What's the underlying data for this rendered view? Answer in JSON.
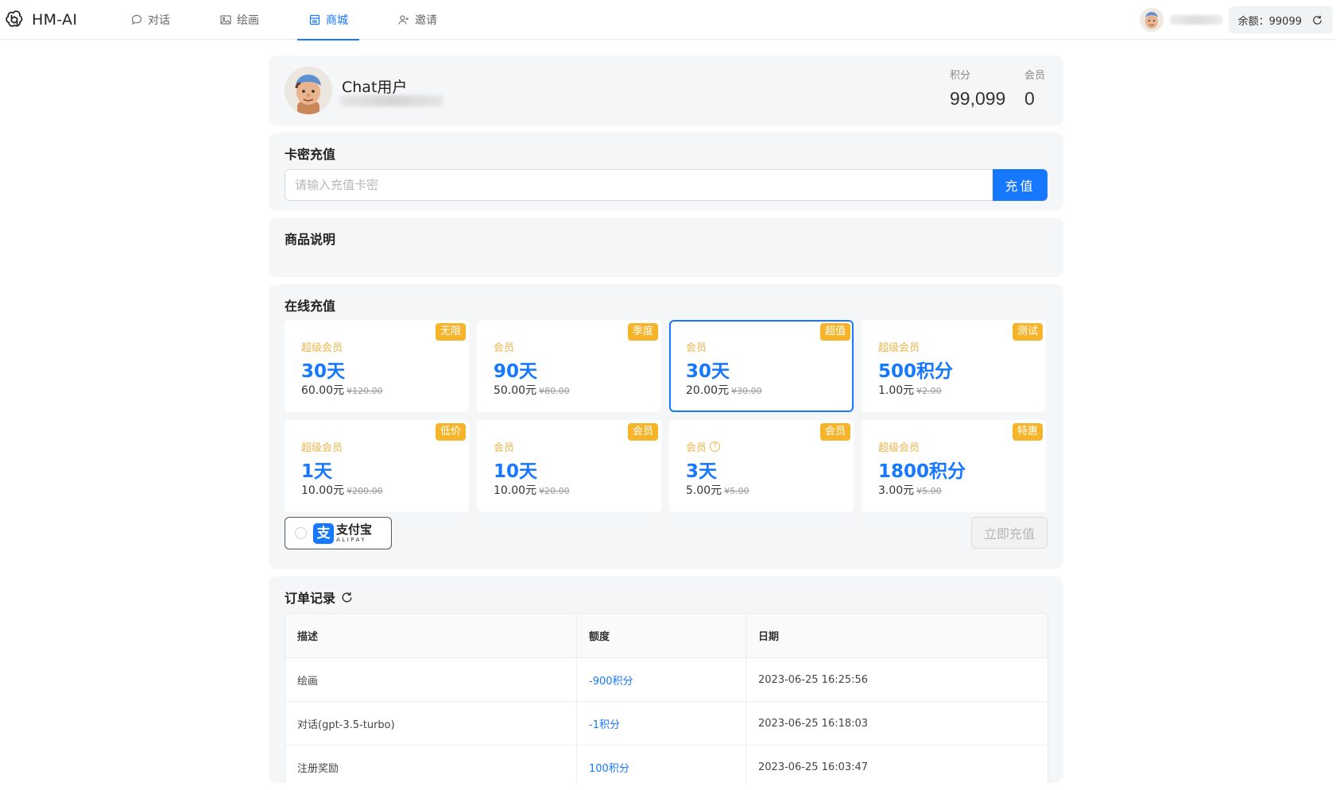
{
  "app": {
    "name": "HM-AI"
  },
  "nav": {
    "items": [
      {
        "label": "对话",
        "icon": "chat-bubble-icon",
        "active": false
      },
      {
        "label": "绘画",
        "icon": "image-icon",
        "active": false
      },
      {
        "label": "商城",
        "icon": "store-icon",
        "active": true
      },
      {
        "label": "邀请",
        "icon": "invite-users-icon",
        "active": false
      }
    ]
  },
  "header": {
    "balance_text": "余额：99099"
  },
  "profile": {
    "name": "Chat用户",
    "points_label": "积分",
    "points_value": "99,099",
    "member_label": "会员",
    "member_value": "0"
  },
  "card_key": {
    "title": "卡密充值",
    "placeholder": "请输入充值卡密",
    "button_label": "充值"
  },
  "description": {
    "title": "商品说明"
  },
  "online": {
    "title": "在线充值",
    "packages": [
      {
        "tag": "无限",
        "type": "超级会员",
        "title": "30天",
        "price": "60.00元",
        "original": "¥120.00",
        "selected": false,
        "help": false
      },
      {
        "tag": "季度",
        "type": "会员",
        "title": "90天",
        "price": "50.00元",
        "original": "¥80.00",
        "selected": false,
        "help": false
      },
      {
        "tag": "超值",
        "type": "会员",
        "title": "30天",
        "price": "20.00元",
        "original": "¥30.00",
        "selected": true,
        "help": false
      },
      {
        "tag": "测试",
        "type": "超级会员",
        "title": "500积分",
        "price": "1.00元",
        "original": "¥2.00",
        "selected": false,
        "help": false
      },
      {
        "tag": "低价",
        "type": "超级会员",
        "title": "1天",
        "price": "10.00元",
        "original": "¥200.00",
        "selected": false,
        "help": false
      },
      {
        "tag": "会员",
        "type": "会员",
        "title": "10天",
        "price": "10.00元",
        "original": "¥20.00",
        "selected": false,
        "help": false
      },
      {
        "tag": "会员",
        "type": "会员",
        "title": "3天",
        "price": "5.00元",
        "original": "¥5.00",
        "selected": false,
        "help": true
      },
      {
        "tag": "特惠",
        "type": "超级会员",
        "title": "1800积分",
        "price": "3.00元",
        "original": "¥5.00",
        "selected": false,
        "help": false
      }
    ],
    "payment": {
      "name_cn": "支付宝",
      "name_en": "ALIPAY",
      "mark": "支"
    },
    "submit_label": "立即充值"
  },
  "orders": {
    "title": "订单记录",
    "columns": [
      "描述",
      "额度",
      "日期"
    ],
    "rows": [
      {
        "desc": "绘画",
        "amount": "-900积分",
        "date": "2023-06-25 16:25:56"
      },
      {
        "desc": "对话(gpt-3.5-turbo)",
        "amount": "-1积分",
        "date": "2023-06-25 16:18:03"
      },
      {
        "desc": "注册奖励",
        "amount": "100积分",
        "date": "2023-06-25 16:03:47"
      }
    ]
  },
  "colors": {
    "accent": "#1677ff",
    "tag": "#f6b42a",
    "member_type": "#f0b54a",
    "card_bg": "#f5f6f8"
  }
}
